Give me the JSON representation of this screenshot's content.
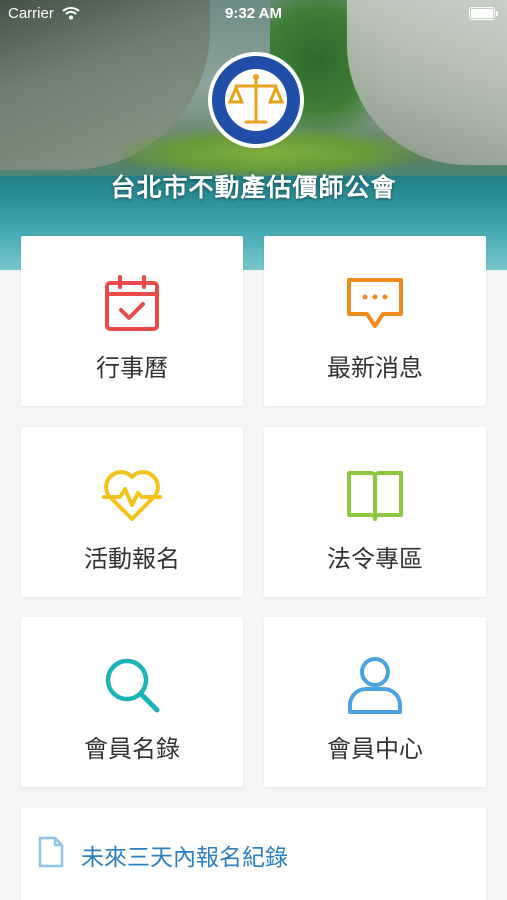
{
  "status_bar": {
    "carrier": "Carrier",
    "time": "9:32 AM"
  },
  "header": {
    "org_name": "台北市不動產估價師公會"
  },
  "menu": [
    {
      "label": "行事曆",
      "icon": "calendar-check-icon",
      "color": "#e94b4b"
    },
    {
      "label": "最新消息",
      "icon": "chat-bubble-icon",
      "color": "#f08a1c"
    },
    {
      "label": "活動報名",
      "icon": "heart-pulse-icon",
      "color": "#f4c21b"
    },
    {
      "label": "法令專區",
      "icon": "open-book-icon",
      "color": "#8dc63f"
    },
    {
      "label": "會員名錄",
      "icon": "search-icon",
      "color": "#1bb3b7"
    },
    {
      "label": "會員中心",
      "icon": "user-icon",
      "color": "#4aa3e0"
    }
  ],
  "registration": {
    "label": "未來三天內報名紀錄",
    "icon": "document-icon",
    "color": "#2c7fc0"
  }
}
